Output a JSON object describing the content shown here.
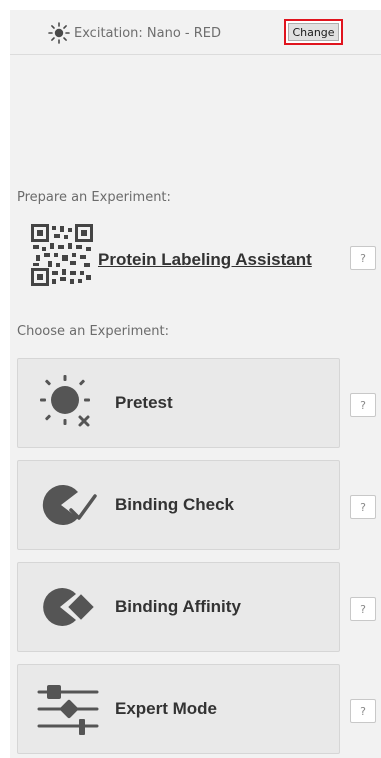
{
  "header": {
    "excitation_label": "Excitation: Nano - RED",
    "change_label": "Change"
  },
  "prepare": {
    "section_label": "Prepare an Experiment:",
    "assistant_label": "Protein Labeling Assistant",
    "help_label": "?"
  },
  "choose": {
    "section_label": "Choose an Experiment:",
    "experiments": [
      {
        "label": "Pretest",
        "icon": "pretest-icon",
        "help_label": "?"
      },
      {
        "label": "Binding Check",
        "icon": "binding-check-icon",
        "help_label": "?"
      },
      {
        "label": "Binding Affinity",
        "icon": "binding-affinity-icon",
        "help_label": "?"
      },
      {
        "label": "Expert Mode",
        "icon": "expert-mode-icon",
        "help_label": "?"
      }
    ]
  },
  "colors": {
    "highlight": "#e0141e",
    "icon": "#555555",
    "panel": "#f2f2f2",
    "button": "#e9e9e9"
  }
}
